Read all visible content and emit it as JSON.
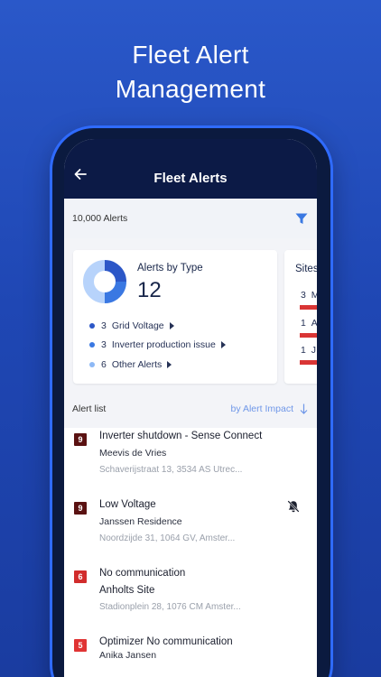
{
  "headline": {
    "line1": "Fleet Alert",
    "line2": "Management"
  },
  "appbar": {
    "title": "Fleet Alerts",
    "back_icon": "arrow-left-icon"
  },
  "countbar": {
    "count_label": "10,000 Alerts",
    "filter_icon": "filter-icon"
  },
  "type_card": {
    "title": "Alerts by Type",
    "total": "12",
    "legend": [
      {
        "count": "3",
        "label": "Grid Voltage",
        "color": "#2c57c7"
      },
      {
        "count": "3",
        "label": "Inverter production issue",
        "color": "#3a78e2"
      },
      {
        "count": "6",
        "label": "Other Alerts",
        "color": "#8db8f5"
      }
    ],
    "donut": [
      {
        "value": 3,
        "color": "#2c57c7"
      },
      {
        "value": 3,
        "color": "#3a78e2"
      },
      {
        "value": 6,
        "color": "#b7d3fb"
      }
    ]
  },
  "site_card": {
    "title": "Sites",
    "rows": [
      {
        "count": "3",
        "label": "M"
      },
      {
        "count": "1",
        "label": "A"
      },
      {
        "count": "1",
        "label": "J"
      }
    ],
    "bar_color": "#d93535"
  },
  "list": {
    "title": "Alert list",
    "sort_label": "by Alert Impact",
    "items": [
      {
        "severity": "9",
        "sev_color": "#5a1212",
        "title": "Inverter shutdown - Sense Connect",
        "site": "Meevis de Vries",
        "address": "Schaverijstraat 13, 3534 AS Utrec..."
      },
      {
        "severity": "9",
        "sev_color": "#5a1212",
        "title": "Low Voltage",
        "site": "Janssen Residence",
        "address": "Noordzijde 31, 1064 GV, Amster...",
        "muted": true
      },
      {
        "severity": "6",
        "sev_color": "#d12c2c",
        "title": "No communication",
        "site": "Anholts Site",
        "address": "Stadionplein 28, 1076 CM Amster..."
      },
      {
        "severity": "5",
        "sev_color": "#e03434",
        "title": "Optimizer No communication",
        "site": "Anika Jansen",
        "address": ""
      }
    ]
  }
}
